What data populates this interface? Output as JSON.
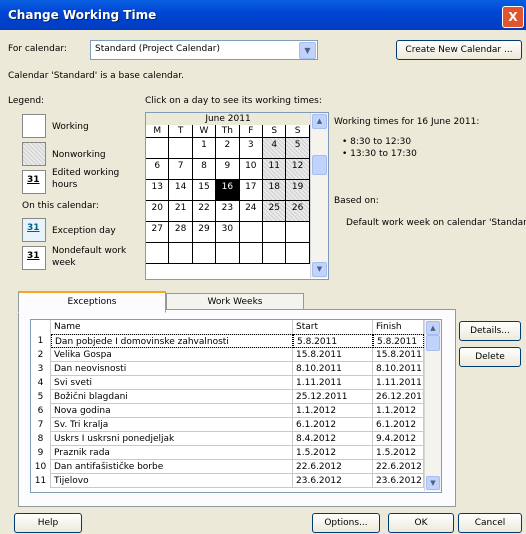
{
  "window": {
    "title": "Change Working Time",
    "close_glyph": "X"
  },
  "for_calendar": {
    "label": "For calendar:",
    "value": "Standard (Project Calendar)",
    "create_button": "Create New Calendar ..."
  },
  "base_note": "Calendar 'Standard' is a base calendar.",
  "legend": {
    "heading": "Legend:",
    "working": "Working",
    "nonworking": "Nonworking",
    "edited_line1": "Edited working",
    "edited_line2": "hours",
    "edited_num": "31",
    "on_this_calendar": "On this calendar:",
    "exception_day": "Exception day",
    "exception_num": "31",
    "nondefault_line1": "Nondefault work",
    "nondefault_line2": "week",
    "nondefault_num": "31"
  },
  "calendar": {
    "instruction": "Click on a day to see its working times:",
    "month": "June 2011",
    "days": [
      "M",
      "T",
      "W",
      "Th",
      "F",
      "S",
      "S"
    ],
    "weeks": [
      [
        "",
        "",
        "1",
        "2",
        "3",
        "4",
        "5"
      ],
      [
        "6",
        "7",
        "8",
        "9",
        "10",
        "11",
        "12"
      ],
      [
        "13",
        "14",
        "15",
        "16",
        "17",
        "18",
        "19"
      ],
      [
        "20",
        "21",
        "22",
        "23",
        "24",
        "25",
        "26"
      ],
      [
        "27",
        "28",
        "29",
        "30",
        "",
        "",
        ""
      ],
      [
        "",
        "",
        "",
        "",
        "",
        "",
        ""
      ]
    ],
    "selected_day": "16"
  },
  "working_times": {
    "heading": "Working times for 16 June 2011:",
    "times": [
      "• 8:30 to 12:30",
      "• 13:30 to 17:30"
    ],
    "based_on": "Based on:",
    "based_text": "Default work week on calendar 'Standard'."
  },
  "tabs": {
    "exceptions": "Exceptions",
    "work_weeks": "Work Weeks"
  },
  "table": {
    "headers": {
      "name": "Name",
      "start": "Start",
      "finish": "Finish"
    },
    "rows": [
      {
        "n": "1",
        "name": "Dan pobjede I domovinske zahvalnosti",
        "start": "5.8.2011",
        "finish": "5.8.2011"
      },
      {
        "n": "2",
        "name": "Velika Gospa",
        "start": "15.8.2011",
        "finish": "15.8.2011"
      },
      {
        "n": "3",
        "name": "Dan neovisnosti",
        "start": "8.10.2011",
        "finish": "8.10.2011"
      },
      {
        "n": "4",
        "name": "Svi sveti",
        "start": "1.11.2011",
        "finish": "1.11.2011"
      },
      {
        "n": "5",
        "name": "Božični blagdani",
        "start": "25.12.2011",
        "finish": "26.12.2011"
      },
      {
        "n": "6",
        "name": "Nova godina",
        "start": "1.1.2012",
        "finish": "1.1.2012"
      },
      {
        "n": "7",
        "name": "Sv. Tri kralja",
        "start": "6.1.2012",
        "finish": "6.1.2012"
      },
      {
        "n": "8",
        "name": "Uskrs I uskrsni ponedjeljak",
        "start": "8.4.2012",
        "finish": "9.4.2012"
      },
      {
        "n": "9",
        "name": "Praznik rada",
        "start": "1.5.2012",
        "finish": "1.5.2012"
      },
      {
        "n": "10",
        "name": "Dan antifašističke borbe",
        "start": "22.6.2012",
        "finish": "22.6.2012"
      },
      {
        "n": "11",
        "name": "Tijelovo",
        "start": "23.6.2012",
        "finish": "23.6.2012"
      }
    ]
  },
  "side_buttons": {
    "details": "Details...",
    "delete": "Delete"
  },
  "footer": {
    "help": "Help",
    "options": "Options...",
    "ok": "OK",
    "cancel": "Cancel"
  }
}
